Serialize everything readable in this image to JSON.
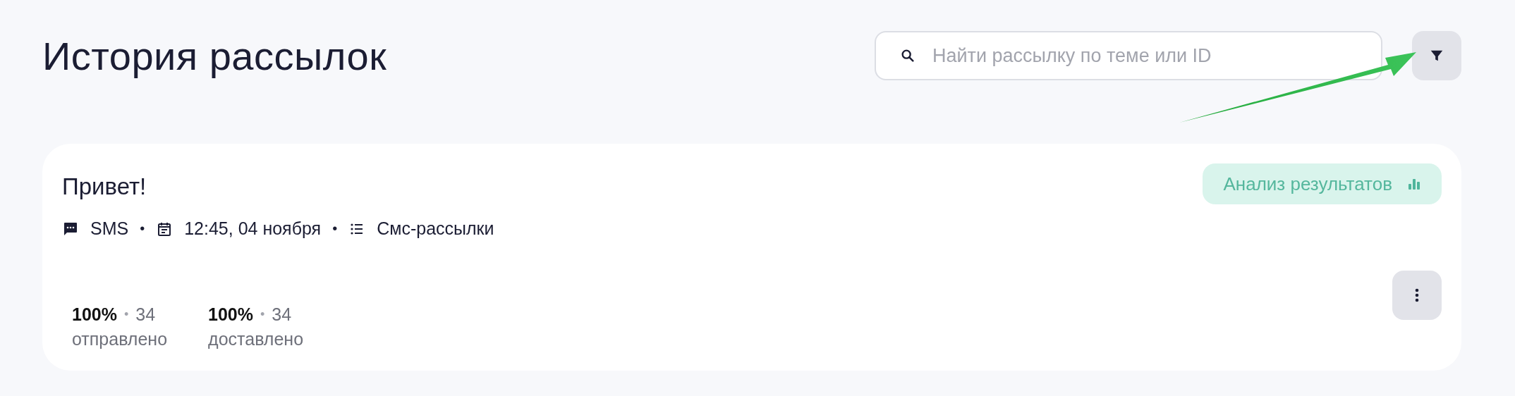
{
  "page_title": "История рассылок",
  "search": {
    "placeholder": "Найти рассылку по теме или ID"
  },
  "filter_button": {
    "highlighted_by_arrow": true
  },
  "mailing": {
    "title": "Привет!",
    "action": "Анализ результатов",
    "meta": [
      {
        "kind": "channel",
        "text": "SMS"
      },
      {
        "kind": "date",
        "text": "12:45, 04 ноября"
      },
      {
        "kind": "list",
        "text": "Смс-рассылки"
      }
    ],
    "meta_separator": "•",
    "stats": [
      {
        "percent": "100%",
        "separator": "•",
        "count": "34",
        "label": "отправлено"
      },
      {
        "percent": "100%",
        "separator": "•",
        "count": "34",
        "label": "доставлено"
      }
    ]
  }
}
